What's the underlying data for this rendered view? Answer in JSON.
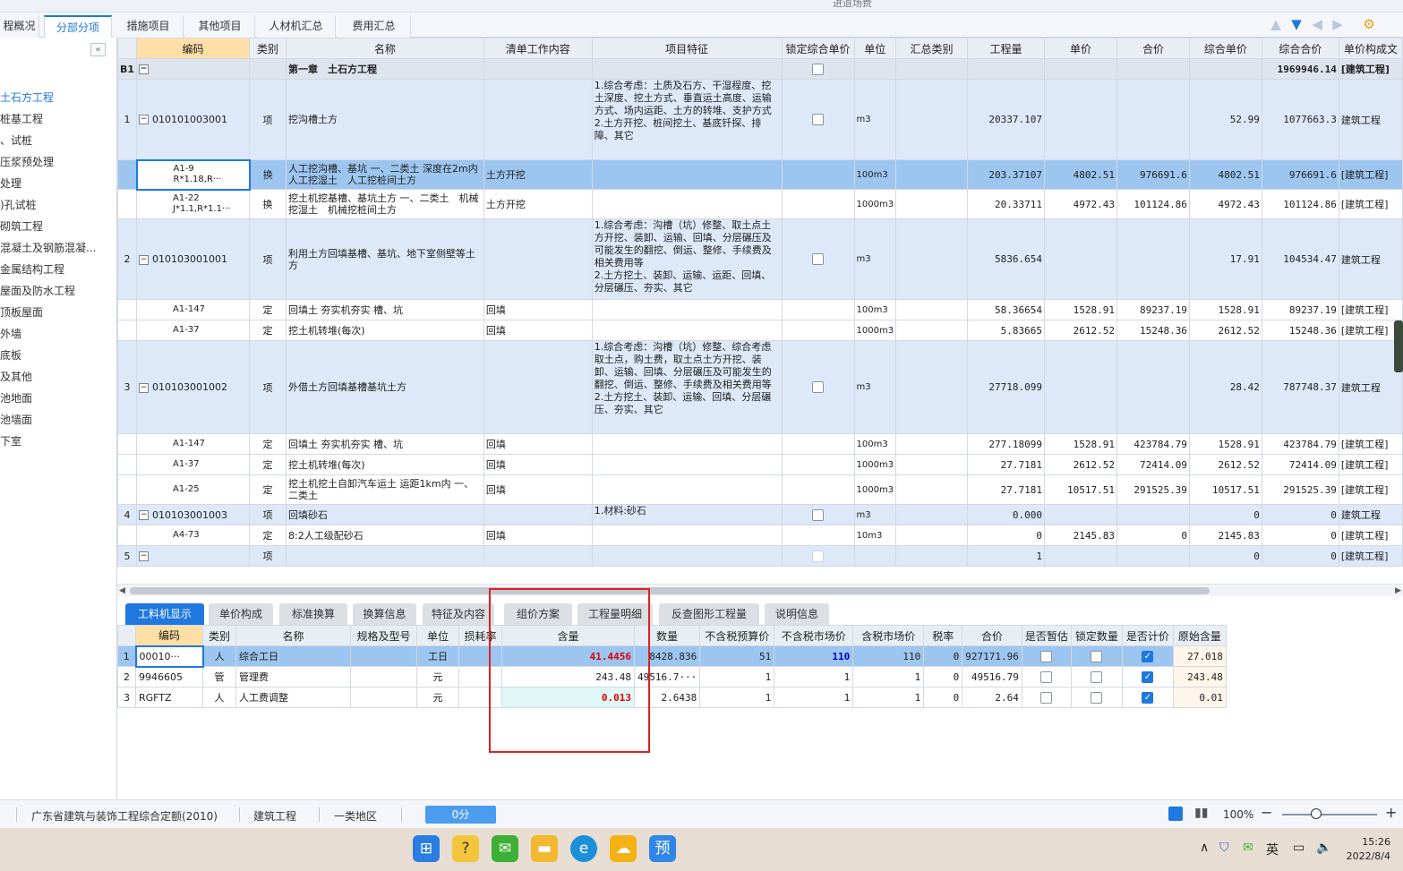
{
  "window_title": "进退场费",
  "top_tabs": [
    "程概况",
    "分部分项",
    "措施项目",
    "其他项目",
    "人材机汇总",
    "费用汇总"
  ],
  "toolbar_icons": [
    "arrow-up-icon",
    "arrow-down-icon",
    "arrow-left-icon",
    "arrow-right-icon",
    "settings-icon"
  ],
  "sidebar": {
    "items": [
      "土石方工程",
      "桩基工程",
      "、试桩",
      "压浆预处理",
      "处理",
      ")孔试桩",
      "砌筑工程",
      "混凝土及钢筋混凝...",
      "金属结构工程",
      "屋面及防水工程",
      "顶板屋面",
      "外墙",
      "底板",
      "及其他",
      "池地面",
      "池墙面",
      "下室"
    ],
    "active_index": 0
  },
  "main_table": {
    "headers": [
      "",
      "编码",
      "类别",
      "名称",
      "清单工作内容",
      "项目特征",
      "锁定综合单价",
      "单位",
      "汇总类别",
      "工程量",
      "单价",
      "合价",
      "综合单价",
      "综合合价",
      "单价构成文"
    ],
    "chapter": {
      "no": "B1",
      "name": "第一章　土石方工程",
      "total": "1969946.14",
      "cat": "[建筑工程]"
    },
    "rows": [
      {
        "type": "qd",
        "no": "1",
        "code": "010101003001",
        "kind": "项",
        "name": "挖沟槽土方",
        "work": "",
        "feature": "1.综合考虑：土质及石方、干湿程度、挖土深度、挖土方式、垂直运土高度、运输方式、场内运距、土方的转堆、支护方式\n2.土方开挖、桩间挖土、基底钎探、排障、其它",
        "lock": true,
        "unit": "m3",
        "qty": "20337.107",
        "price": "",
        "amount": "",
        "cprice": "52.99",
        "camount": "1077663.3",
        "cat": "建筑工程"
      },
      {
        "type": "sel",
        "no": "",
        "code": "A1-9\nR*1.18,R···",
        "kind": "换",
        "name": "人工挖沟槽、基坑 一、二类土 深度在2m内　人工挖湿土　人工挖桩间土方",
        "work": "土方开挖",
        "feature": "",
        "lock": false,
        "unit": "100m3",
        "qty": "203.37107",
        "price": "4802.51",
        "amount": "976691.6",
        "cprice": "4802.51",
        "camount": "976691.6",
        "cat": "[建筑工程]"
      },
      {
        "type": "de",
        "no": "",
        "code": "A1-22\nJ*1.1,R*1.1···",
        "kind": "换",
        "name": "挖土机挖基槽、基坑土方 一、二类土　机械挖湿土　机械挖桩间土方",
        "work": "土方开挖",
        "feature": "",
        "lock": false,
        "unit": "1000m3",
        "qty": "20.33711",
        "price": "4972.43",
        "amount": "101124.86",
        "cprice": "4972.43",
        "camount": "101124.86",
        "cat": "[建筑工程]"
      },
      {
        "type": "qd",
        "no": "2",
        "code": "010103001001",
        "kind": "项",
        "name": "利用土方回填基槽、基坑、地下室侧壁等土方",
        "work": "",
        "feature": "1.综合考虑：沟槽（坑）修整、取土点土方开挖、装卸、运输、回填、分层碾压及可能发生的翻挖、倒运、整修、手续费及相关费用等\n2.土方挖土、装卸、运输、运距、回填、分层碾压、夯实、其它",
        "lock": true,
        "unit": "m3",
        "qty": "5836.654",
        "price": "",
        "amount": "",
        "cprice": "17.91",
        "camount": "104534.47",
        "cat": "建筑工程"
      },
      {
        "type": "de",
        "no": "",
        "code": "A1-147",
        "kind": "定",
        "name": "回填土 夯实机夯实 槽、坑",
        "work": "回填",
        "feature": "",
        "lock": false,
        "unit": "100m3",
        "qty": "58.36654",
        "price": "1528.91",
        "amount": "89237.19",
        "cprice": "1528.91",
        "camount": "89237.19",
        "cat": "[建筑工程]"
      },
      {
        "type": "de",
        "no": "",
        "code": "A1-37",
        "kind": "定",
        "name": "挖土机转堆(每次)",
        "work": "回填",
        "feature": "",
        "lock": false,
        "unit": "1000m3",
        "qty": "5.83665",
        "price": "2612.52",
        "amount": "15248.36",
        "cprice": "2612.52",
        "camount": "15248.36",
        "cat": "[建筑工程]"
      },
      {
        "type": "qd",
        "no": "3",
        "code": "010103001002",
        "kind": "项",
        "name": "外借土方回填基槽基坑土方",
        "work": "",
        "feature": "1.综合考虑：沟槽（坑）修整、综合考虑取土点，购土费，取土点土方开挖、装卸、运输、回填、分层碾压及可能发生的翻挖、倒运、整修、手续费及相关费用等\n2.土方挖土、装卸、运输、回填、分层碾压、夯实、其它",
        "lock": true,
        "unit": "m3",
        "qty": "27718.099",
        "price": "",
        "amount": "",
        "cprice": "28.42",
        "camount": "787748.37",
        "cat": "建筑工程"
      },
      {
        "type": "de",
        "no": "",
        "code": "A1-147",
        "kind": "定",
        "name": "回填土 夯实机夯实 槽、坑",
        "work": "回填",
        "feature": "",
        "lock": false,
        "unit": "100m3",
        "qty": "277.18099",
        "price": "1528.91",
        "amount": "423784.79",
        "cprice": "1528.91",
        "camount": "423784.79",
        "cat": "[建筑工程]"
      },
      {
        "type": "de",
        "no": "",
        "code": "A1-37",
        "kind": "定",
        "name": "挖土机转堆(每次)",
        "work": "回填",
        "feature": "",
        "lock": false,
        "unit": "1000m3",
        "qty": "27.7181",
        "price": "2612.52",
        "amount": "72414.09",
        "cprice": "2612.52",
        "camount": "72414.09",
        "cat": "[建筑工程]"
      },
      {
        "type": "de",
        "no": "",
        "code": "A1-25",
        "kind": "定",
        "name": "挖土机挖土自卸汽车运土 运距1km内 一、二类土",
        "work": "回填",
        "feature": "",
        "lock": false,
        "unit": "1000m3",
        "qty": "27.7181",
        "price": "10517.51",
        "amount": "291525.39",
        "cprice": "10517.51",
        "camount": "291525.39",
        "cat": "[建筑工程]"
      },
      {
        "type": "qd",
        "no": "4",
        "code": "010103001003",
        "kind": "项",
        "name": "回填砂石",
        "work": "",
        "feature": "1.材料:砂石",
        "lock": true,
        "unit": "m3",
        "qty": "0.000",
        "price": "",
        "amount": "",
        "cprice": "0",
        "camount": "0",
        "cat": "建筑工程"
      },
      {
        "type": "de",
        "no": "",
        "code": "A4-73",
        "kind": "定",
        "name": "8:2人工级配砂石",
        "work": "回填",
        "feature": "",
        "lock": false,
        "unit": "10m3",
        "qty": "0",
        "price": "2145.83",
        "amount": "0",
        "cprice": "2145.83",
        "camount": "0",
        "cat": "[建筑工程]"
      },
      {
        "type": "qd",
        "no": "5",
        "code": "",
        "kind": "项",
        "name": "",
        "work": "",
        "feature": "",
        "lock": true,
        "lock_disabled": true,
        "unit": "",
        "qty": "1",
        "price": "",
        "amount": "",
        "cprice": "0",
        "camount": "0",
        "cat": "[建筑工程]"
      }
    ]
  },
  "bottom_tabs": [
    "工料机显示",
    "单价构成",
    "标准换算",
    "换算信息",
    "特征及内容",
    "组价方案",
    "工程量明细",
    "反查图形工程量",
    "说明信息"
  ],
  "sub_table": {
    "headers": [
      "",
      "编码",
      "类别",
      "名称",
      "规格及型号",
      "单位",
      "损耗率",
      "含量",
      "数量",
      "不含税预算价",
      "不含税市场价",
      "含税市场价",
      "税率",
      "合价",
      "是否暂估",
      "锁定数量",
      "是否计价",
      "原始含量"
    ],
    "rows": [
      {
        "no": "1",
        "code": "00010···",
        "kind": "人",
        "name": "综合工日",
        "spec": "",
        "unit": "工日",
        "loss": "",
        "content": "41.4456",
        "qty": "8428.836",
        "pre": "51",
        "mkt": "110",
        "mkt_tax": "110",
        "tax": "0",
        "amount": "927171.96",
        "est": false,
        "lockq": false,
        "priced": true,
        "orig": "27.018"
      },
      {
        "no": "2",
        "code": "9946605",
        "kind": "管",
        "name": "管理费",
        "spec": "",
        "unit": "元",
        "loss": "",
        "content": "243.48",
        "qty": "49516.7···",
        "pre": "1",
        "mkt": "1",
        "mkt_tax": "1",
        "tax": "0",
        "amount": "49516.79",
        "est": false,
        "lockq": false,
        "priced": true,
        "orig": "243.48"
      },
      {
        "no": "3",
        "code": "RGFTZ",
        "kind": "人",
        "name": "人工费调整",
        "spec": "",
        "unit": "元",
        "loss": "",
        "content": "0.013",
        "qty": "2.6438",
        "pre": "1",
        "mkt": "1",
        "mkt_tax": "1",
        "tax": "0",
        "amount": "2.64",
        "est": false,
        "lockq": false,
        "priced": true,
        "orig": "0.01"
      }
    ]
  },
  "status": {
    "quota": "广东省建筑与装饰工程综合定额(2010)",
    "type": "建筑工程",
    "region": "一类地区",
    "progress": "0分",
    "zoom": "100%"
  },
  "taskbar": {
    "time": "15:26",
    "date": "2022/8/4",
    "ime": "英"
  }
}
